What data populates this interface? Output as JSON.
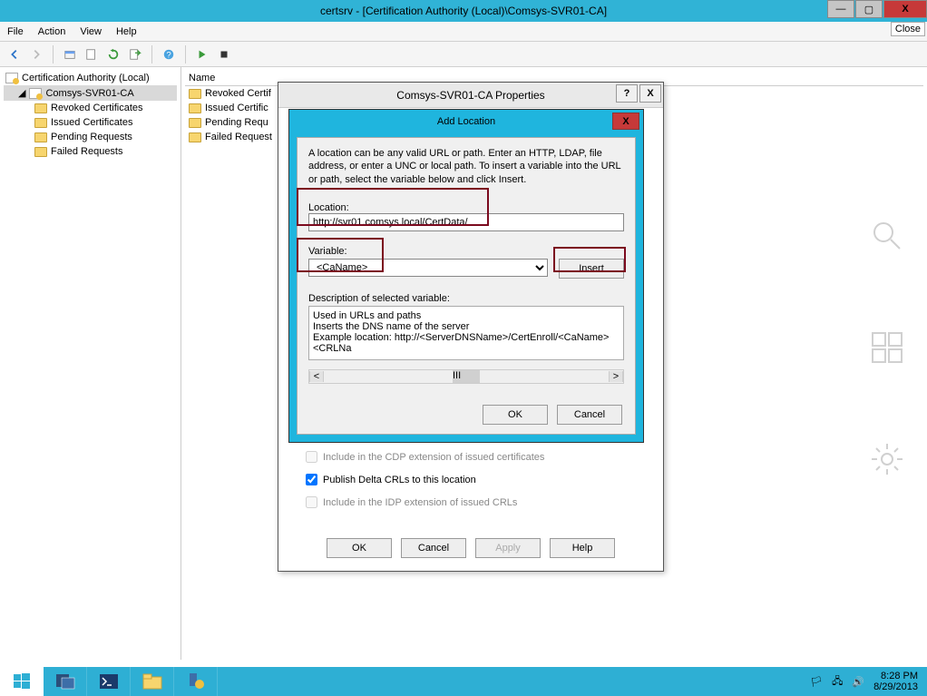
{
  "window": {
    "title": "certsrv - [Certification Authority (Local)\\Comsys-SVR01-CA]",
    "close_tip": "Close"
  },
  "menu": {
    "file": "File",
    "action": "Action",
    "view": "View",
    "help": "Help"
  },
  "tree": {
    "root": "Certification Authority (Local)",
    "ca": "Comsys-SVR01-CA",
    "nodes": [
      "Revoked Certificates",
      "Issued Certificates",
      "Pending Requests",
      "Failed Requests"
    ]
  },
  "list": {
    "header": "Name",
    "rows": [
      "Revoked Certif",
      "Issued Certific",
      "Pending Requ",
      "Failed Request"
    ]
  },
  "props": {
    "title": "Comsys-SVR01-CA Properties",
    "help_q": "?",
    "close_x": "X",
    "chk_cdp": "Include in the CDP extension of issued certificates",
    "chk_delta": "Publish Delta CRLs to this location",
    "chk_idp": "Include in the IDP extension of issued CRLs",
    "ok": "OK",
    "cancel": "Cancel",
    "apply": "Apply",
    "help": "Help"
  },
  "addloc": {
    "title": "Add Location",
    "close_x": "X",
    "instr": "A location can be any valid URL or path. Enter an HTTP, LDAP, file address, or enter a UNC or local path. To insert a variable into the URL or path, select the variable below and click Insert.",
    "loc_lbl": "Location:",
    "loc_val": "http://svr01.comsys.local/CertData/",
    "var_lbl": "Variable:",
    "var_val": "<CaName>",
    "insert": "Insert",
    "desc_lbl": "Description of selected variable:",
    "desc1": "Used in URLs and paths",
    "desc2": "Inserts the DNS name of the server",
    "desc3": "Example location: http://<ServerDNSName>/CertEnroll/<CaName><CRLNa",
    "scroll_thumb": "III",
    "ok": "OK",
    "cancel": "Cancel"
  },
  "taskbar": {
    "time": "8:28 PM",
    "date": "8/29/2013"
  }
}
